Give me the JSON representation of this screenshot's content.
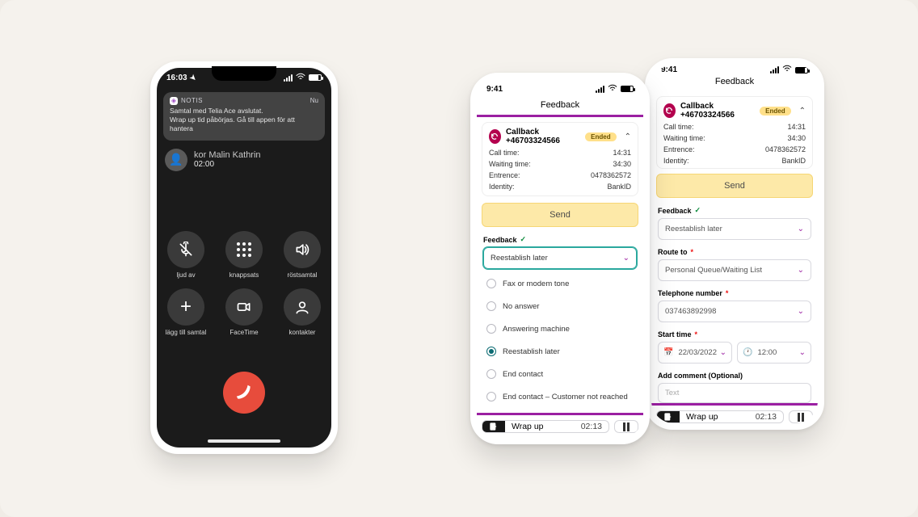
{
  "phone1": {
    "time": "16:03",
    "notif": {
      "app": "NOTIS",
      "when": "Nu",
      "line1": "Samtal med Telia Ace avslutat.",
      "line2": "Wrap up tid påbörjas. Gå till appen för att hantera"
    },
    "caller": {
      "top": "kor    Malin Kathrin",
      "timer": "02:00"
    },
    "buttons": {
      "r1c1": "ljud av",
      "r1c2": "knappsats",
      "r1c3": "röstsamtal",
      "r2c1": "lägg till samtal",
      "r2c2": "FaceTime",
      "r2c3": "kontakter"
    }
  },
  "appCommon": {
    "time": "9:41",
    "title": "Feedback",
    "callback_title": "Callback +46703324566",
    "badge": "Ended",
    "kv": {
      "k1": "Call time:",
      "v1": "14:31",
      "k2": "Waiting time:",
      "v2": "34:30",
      "k3": "Entrence:",
      "v3": "0478362572",
      "k4": "Identity:",
      "v4": "BankID"
    },
    "send": "Send",
    "feedback_label": "Feedback",
    "selected_feedback": "Reestablish later",
    "wrap_label": "Wrap up",
    "wrap_time": "02:13"
  },
  "phone2": {
    "options": [
      "Fax or modem tone",
      "No answer",
      "Answering machine",
      "Reestablish later",
      "End contact",
      "End contact – Customer not reached"
    ],
    "selected_index": 3
  },
  "phone3": {
    "route_label": "Route to",
    "route_value": "Personal Queue/Waiting List",
    "tel_label": "Telephone number",
    "tel_value": "037463892998",
    "start_label": "Start time",
    "date_value": "22/03/2022",
    "time_value": "12:00",
    "comment_label": "Add comment (Optional)",
    "comment_placeholder": "Text"
  }
}
